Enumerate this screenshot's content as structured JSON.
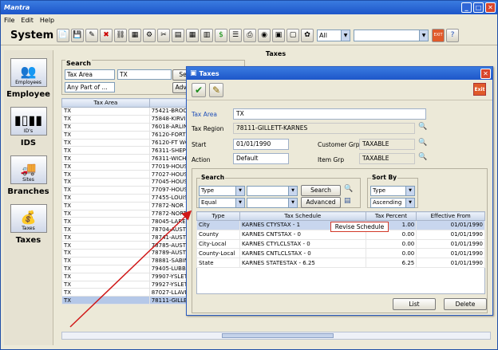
{
  "app": {
    "title": "Mantra",
    "system_label": "System"
  },
  "menu": [
    "File",
    "Edit",
    "Help"
  ],
  "toolbar": {
    "filter_select": "All"
  },
  "nav": [
    {
      "label": "Employee",
      "icon_caption": "Employees"
    },
    {
      "label": "IDS",
      "icon_caption": "ID's"
    },
    {
      "label": "Branches",
      "icon_caption": "Sites"
    },
    {
      "label": "Taxes",
      "icon_caption": "Taxes"
    }
  ],
  "bg_panel": {
    "title": "Taxes",
    "search_legend": "Search",
    "field_type": "Tax Area",
    "field_value": "TX",
    "field_match": "Any Part of ...",
    "search_btn": "Se",
    "adv_btn": "Adva",
    "columns": [
      "Tax Area"
    ],
    "rows": [
      [
        "TX",
        "75421-BROO"
      ],
      [
        "TX",
        "75848-KIRVIN"
      ],
      [
        "TX",
        "76018-ARLIN"
      ],
      [
        "TX",
        "76120-FORT"
      ],
      [
        "TX",
        "76120-FT WO"
      ],
      [
        "TX",
        "76311-SHEP"
      ],
      [
        "TX",
        "76311-WICHI"
      ],
      [
        "TX",
        "77019-HOUS"
      ],
      [
        "TX",
        "77027-HOUS"
      ],
      [
        "TX",
        "77045-HOUS"
      ],
      [
        "TX",
        "77097-HOUS"
      ],
      [
        "TX",
        "77455-LOUIS"
      ],
      [
        "TX",
        "77872-NOR"
      ],
      [
        "TX",
        "77872-NORT"
      ],
      [
        "TX",
        "78045-LARED"
      ],
      [
        "TX",
        "78704-AUSTI"
      ],
      [
        "TX",
        "78741-AUSTI"
      ],
      [
        "TX",
        "78785-AUSTI"
      ],
      [
        "TX",
        "78789-AUSTI"
      ],
      [
        "TX",
        "78881-SABIN"
      ],
      [
        "TX",
        "79405-LUBB"
      ],
      [
        "TX",
        "79907-YSLET"
      ],
      [
        "TX",
        "79927-YSLET"
      ],
      [
        "TX",
        "87027-LLAVE"
      ]
    ],
    "selected_row": {
      "area": "TX",
      "region": "78111-GILLETT-KARNES",
      "start": "01/01/1990",
      "grp": "TAXABLE",
      "item_grp": "TAXABLE",
      "action": "Default"
    }
  },
  "dialog": {
    "title": "Taxes",
    "labels": {
      "tax_area": "Tax Area",
      "tax_region": "Tax Region",
      "start": "Start",
      "action": "Action",
      "customer_grp": "Customer Grp",
      "item_grp": "Item Grp"
    },
    "values": {
      "tax_area": "TX",
      "tax_region": "78111-GILLETT-KARNES",
      "start": "01/01/1990",
      "action": "Default",
      "customer_grp": "TAXABLE",
      "item_grp": "TAXABLE"
    },
    "search": {
      "legend": "Search",
      "field1": "Type",
      "field2": "Equal",
      "search_btn": "Search",
      "advanced_btn": "Advanced"
    },
    "sort": {
      "legend": "Sort By",
      "field1": "Type",
      "field2": "Ascending"
    },
    "columns": [
      "Type",
      "Tax Schedule",
      "Tax Percent",
      "Effective From"
    ],
    "rows": [
      [
        "City",
        "KARNES CTYSTAX - 1",
        "1.00",
        "01/01/1990"
      ],
      [
        "County",
        "KARNES CNTSTAX - 0",
        "0.00",
        "01/01/1990"
      ],
      [
        "City-Local",
        "KARNES CTYLCLSTAX - 0",
        "0.00",
        "01/01/1990"
      ],
      [
        "County-Local",
        "KARNES CNTLCLSTAX - 0",
        "0.00",
        "01/01/1990"
      ],
      [
        "State",
        "KARNES STATESTAX - 6.25",
        "6.25",
        "01/01/1990"
      ]
    ],
    "context_menu": "Revise Schedule",
    "list_btn": "List",
    "delete_btn": "Delete",
    "exit_label": "Exit"
  }
}
